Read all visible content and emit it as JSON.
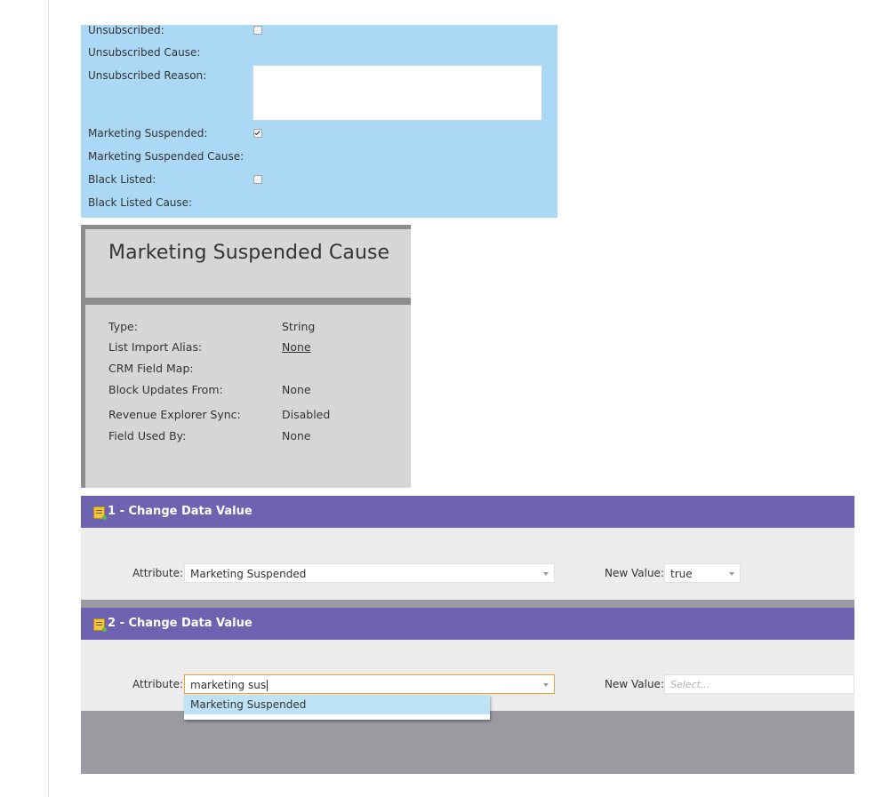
{
  "lead_status": {
    "rows": [
      {
        "label": "Unsubscribed:",
        "type": "checkbox",
        "checked": false
      },
      {
        "label": "Unsubscribed Cause:",
        "type": "text",
        "value": ""
      },
      {
        "label": "Unsubscribed Reason:",
        "type": "textarea",
        "value": ""
      },
      {
        "label": "Marketing Suspended:",
        "type": "checkbox",
        "checked": true
      },
      {
        "label": "Marketing Suspended Cause:",
        "type": "text",
        "value": ""
      },
      {
        "label": "Black Listed:",
        "type": "checkbox",
        "checked": false
      },
      {
        "label": "Black Listed Cause:",
        "type": "text",
        "value": ""
      }
    ]
  },
  "field_card": {
    "title": "Marketing Suspended Cause",
    "properties": [
      {
        "label": "Type:",
        "value": "String"
      },
      {
        "label": "List Import Alias:",
        "value": "None"
      },
      {
        "label": "CRM Field Map:",
        "value": ""
      },
      {
        "label": "Block Updates From:",
        "value": "None"
      },
      {
        "label": "Revenue Explorer Sync:",
        "value": "Disabled"
      },
      {
        "label": "Field Used By:",
        "value": "None"
      }
    ]
  },
  "flow_steps": [
    {
      "title": "1 - Change Data Value",
      "attribute_label": "Attribute:",
      "attribute_value": "Marketing Suspended",
      "new_value_label": "New Value:",
      "new_value": "true"
    },
    {
      "title": "2 - Change Data Value",
      "attribute_label": "Attribute:",
      "attribute_value": "marketing sus",
      "new_value_label": "New Value:",
      "new_value_placeholder": "Select...",
      "suggestions": [
        "Marketing Suspended"
      ]
    }
  ],
  "colors": {
    "lead_panel_bg": "#abd9f5",
    "card_bg": "#d6d6d6",
    "step_header_bg": "#6e63b0",
    "step_body_bg": "#ececec",
    "flow_bg": "#9a9aa0",
    "focus_border": "#e9a53a",
    "suggestion_highlight": "#bfe3f6"
  },
  "icons": {
    "checkbox": "checkbox-icon",
    "step": "flow-step-icon",
    "dropdown": "chevron-down-icon"
  }
}
